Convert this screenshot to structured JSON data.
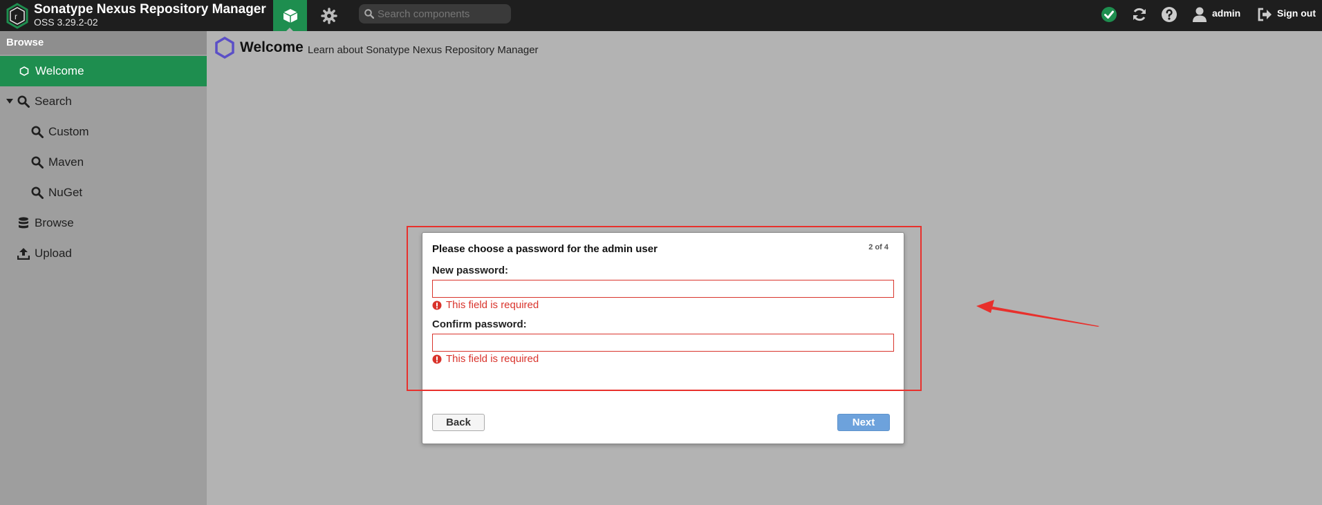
{
  "topbar": {
    "app_title": "Sonatype Nexus Repository Manager",
    "app_version": "OSS 3.29.2-02",
    "search_placeholder": "Search components",
    "user_label": "admin",
    "signout_label": "Sign out"
  },
  "sidebar": {
    "header": "Browse",
    "items": [
      {
        "label": "Welcome"
      },
      {
        "label": "Search"
      },
      {
        "label": "Custom"
      },
      {
        "label": "Maven"
      },
      {
        "label": "NuGet"
      },
      {
        "label": "Browse"
      },
      {
        "label": "Upload"
      }
    ]
  },
  "main": {
    "title": "Welcome",
    "subtitle": "Learn about Sonatype Nexus Repository Manager"
  },
  "dialog": {
    "title": "Please choose a password for the admin user",
    "step": "2 of 4",
    "new_password_label": "New password:",
    "confirm_password_label": "Confirm password:",
    "error_text": "This field is required",
    "back_label": "Back",
    "next_label": "Next"
  },
  "colors": {
    "accent": "#1e8e4f",
    "error": "#d9332b",
    "annotation": "#e8302c",
    "next_button": "#6da2dc"
  }
}
